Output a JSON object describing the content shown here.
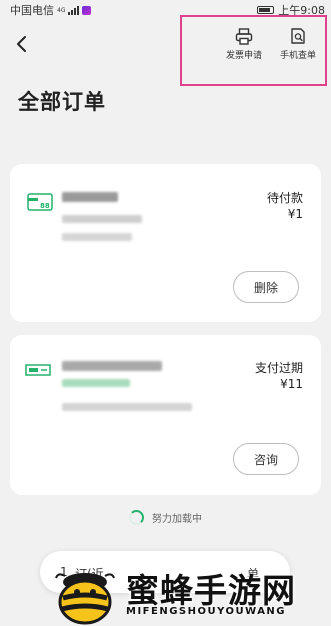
{
  "status_bar": {
    "carrier": "中国电信",
    "network_badge": "4G",
    "time": "上午9:08"
  },
  "header": {
    "back_icon": "chevron-left-icon",
    "actions": [
      {
        "label": "发票申请",
        "icon": "printer-icon"
      },
      {
        "label": "手机查单",
        "icon": "document-search-icon"
      }
    ]
  },
  "page": {
    "title": "全部订单"
  },
  "orders": [
    {
      "status": "待付款",
      "price": "¥1",
      "action": "删除",
      "icon": "card-icon"
    },
    {
      "status": "支付过期",
      "price": "¥11",
      "action": "咨询",
      "icon": "ticket-icon"
    }
  ],
  "loading": {
    "text": "努力加载中"
  },
  "bottom_bar": {
    "left_text": "1",
    "mid_text": "订(近",
    "right_text": "单"
  },
  "watermark": {
    "title": "蜜蜂手游网",
    "subtitle": "MIFENGSHOUYOUWANG"
  },
  "colors": {
    "accent_green": "#23b26b",
    "highlight_pink": "#e0418c",
    "background": "#f1f1f1"
  }
}
